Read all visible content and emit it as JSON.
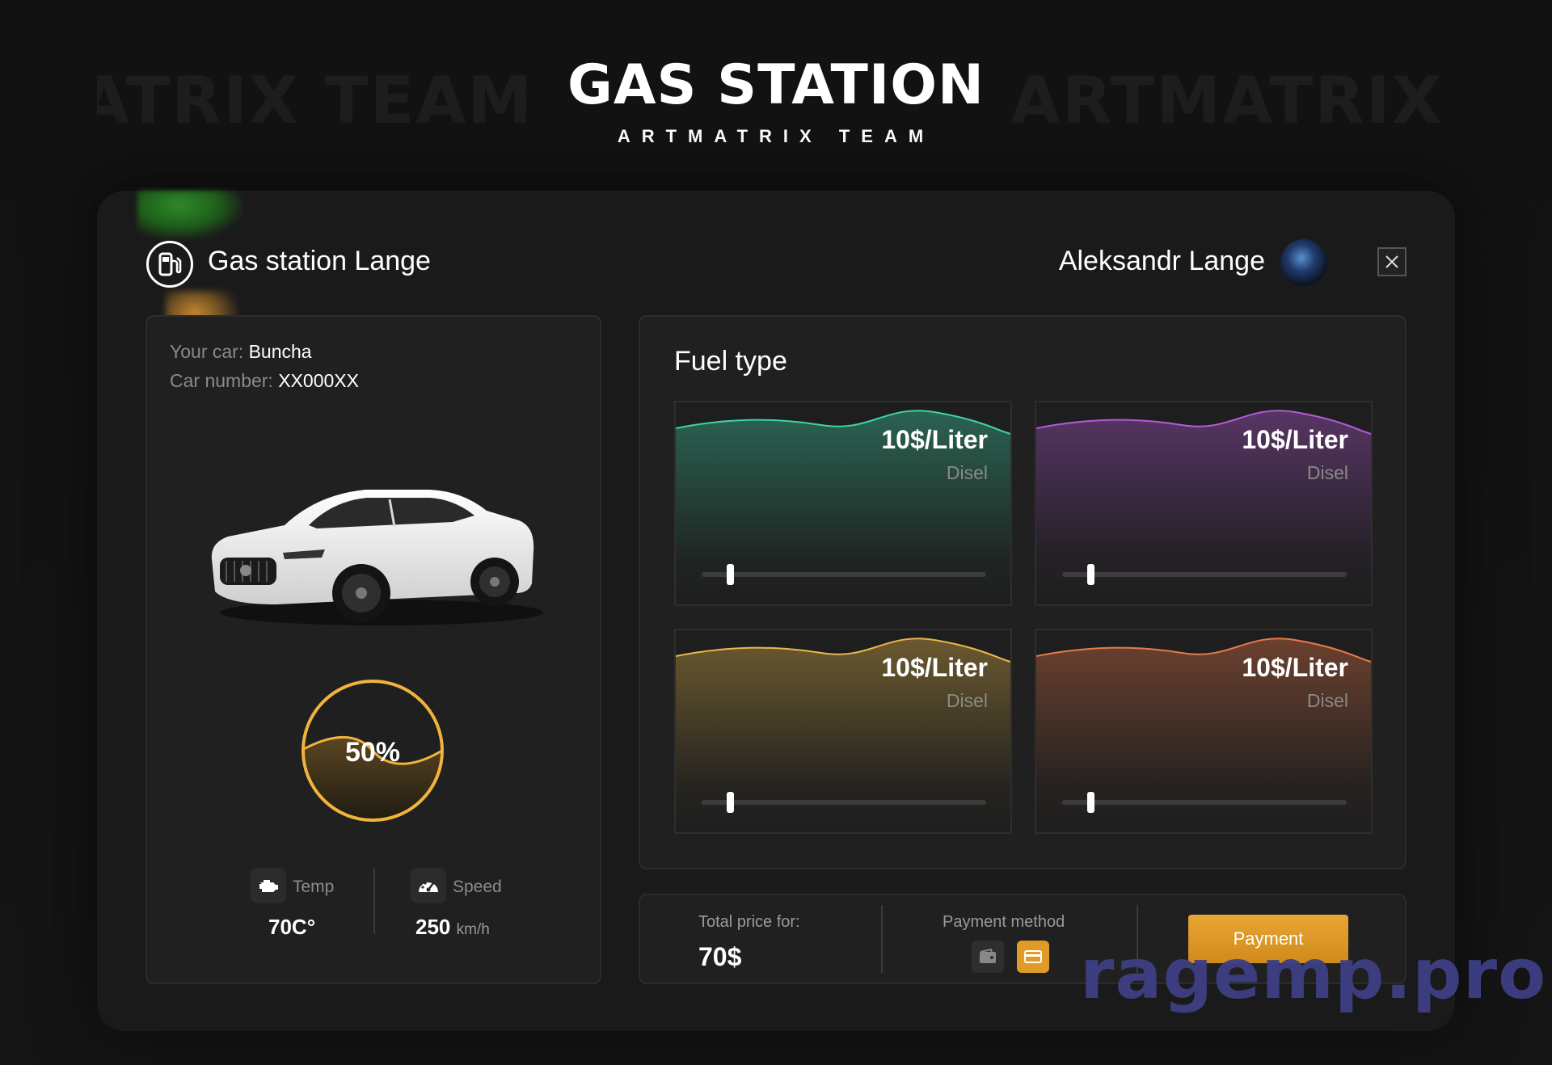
{
  "header": {
    "title": "GAS STATION",
    "subtitle": "ARTMATRIX TEAM"
  },
  "topbar": {
    "station_name": "Gas station Lange",
    "user_name": "Aleksandr Lange",
    "close_icon": "close-icon",
    "station_icon": "gas-station-icon"
  },
  "car": {
    "car_label": "Your car:",
    "car_value": "Buncha",
    "number_label": "Car number:",
    "number_value": "XX000XX",
    "fuel_level_text": "50%",
    "fuel_level": 0.5,
    "gauge_color": "#f0b43c",
    "stats": {
      "temp_label": "Temp",
      "temp_value": "70C°",
      "temp_icon": "engine-icon",
      "speed_label": "Speed",
      "speed_value": "250",
      "speed_unit": "km/h",
      "speed_icon": "speedometer-icon"
    }
  },
  "fuel": {
    "title": "Fuel type",
    "cards": [
      {
        "price": "10$/Liter",
        "name": "Disel",
        "color": "#3fd4a8",
        "slider": 0.1
      },
      {
        "price": "10$/Liter",
        "name": "Disel",
        "color": "#b55bd9",
        "slider": 0.1
      },
      {
        "price": "10$/Liter",
        "name": "Disel",
        "color": "#e8b84a",
        "slider": 0.1
      },
      {
        "price": "10$/Liter",
        "name": "Disel",
        "color": "#e8794a",
        "slider": 0.1
      }
    ]
  },
  "payment": {
    "total_label": "Total price for:",
    "total_value": "70$",
    "method_label": "Payment method",
    "methods": [
      "wallet-icon",
      "card-icon"
    ],
    "selected_method": "card-icon",
    "button_label": "Payment",
    "accent": "#e09a28"
  },
  "watermark": "ragemp.pro"
}
